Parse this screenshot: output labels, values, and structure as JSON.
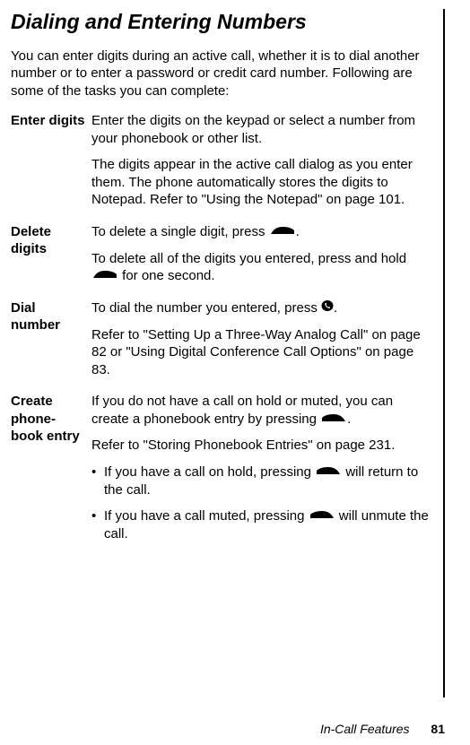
{
  "heading": "Dialing and Entering Numbers",
  "intro": "You can enter digits during an active call, whether it is to dial another number or to enter a password or credit card number. Following are some of the tasks you can complete:",
  "rows": {
    "enter": {
      "label": "Enter digits",
      "p1": "Enter the digits on the keypad or select a number from your phonebook or other list.",
      "p2": "The digits appear in the active call dialog as you enter them. The phone automatically stores the digits to Notepad. Refer to \"Using the Notepad\" on page 101."
    },
    "delete": {
      "label": "Delete digits",
      "p1a": "To delete a single digit, press ",
      "p1b": ".",
      "p2a": "To delete all of the digits you entered, press and hold ",
      "p2b": " for one second."
    },
    "dial": {
      "label": "Dial number",
      "p1a": "To dial the number you entered, press ",
      "p1b": ".",
      "p2": "Refer to \"Setting Up a Three-Way Analog Call\" on page 82 or \"Using Digital Conference Call Options\" on page 83."
    },
    "create": {
      "label": "Create phone-book entry",
      "p1a": "If you do not have a call on hold or muted, you can create a phonebook entry by pressing ",
      "p1b": ".",
      "p2": "Refer to \"Storing Phonebook Entries\" on page 231.",
      "b1a": "If you have a call on hold, pressing ",
      "b1b": " will return to the call.",
      "b2a": "If you have a call muted, pressing ",
      "b2b": " will unmute the call."
    }
  },
  "footer": {
    "section": "In-Call Features",
    "page": "81"
  }
}
